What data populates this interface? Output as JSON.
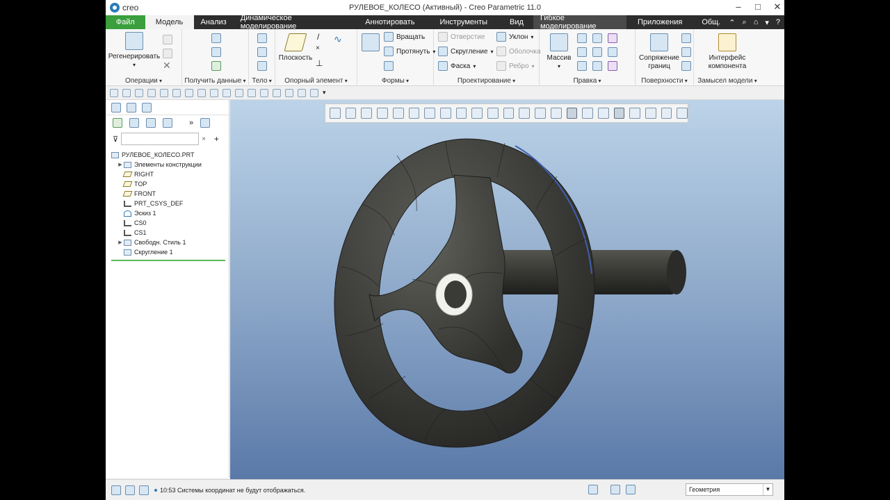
{
  "app": {
    "logo": "creo",
    "title": "РУЛЕВОЕ_КОЛЕСО (Активный) - Creo Parametric 11.0"
  },
  "tabs": {
    "file": "Файл",
    "model": "Модель",
    "analysis": "Анализ",
    "dynamic": "Динамическое моделирование",
    "annotate": "Аннотировать",
    "tools": "Инструменты",
    "view": "Вид",
    "flex": "Гибкое моделирование",
    "apps": "Приложения",
    "common": "Общ."
  },
  "ribbon": {
    "operations": {
      "label": "Операции",
      "regen": "Регенерировать"
    },
    "get_data": {
      "label": "Получить данные"
    },
    "body": {
      "label": "Тело"
    },
    "datum": {
      "label": "Опорный элемент",
      "plane": "Плоскость"
    },
    "shapes": {
      "label": "Формы",
      "revolve": "Вращать",
      "extrude": "Протянуть"
    },
    "engineering": {
      "label": "Проектирование",
      "hole": "Отверстие",
      "round": "Скругление",
      "chamfer": "Фаска",
      "draft": "Уклон",
      "shell": "Оболочка",
      "rib": "Ребро"
    },
    "editing": {
      "label": "Правка",
      "pattern": "Массив"
    },
    "surfaces": {
      "label": "Поверхности",
      "boundary": "Сопряжение границ"
    },
    "intent": {
      "label": "Замысел модели",
      "component_interface": "Интерфейс компонента"
    }
  },
  "tree": {
    "search_placeholder": "",
    "items": [
      {
        "label": "РУЛЕВОЕ_КОЛЕСО.PRT"
      },
      {
        "label": "Элементы конструкции"
      },
      {
        "label": "RIGHT"
      },
      {
        "label": "TOP"
      },
      {
        "label": "FRONT"
      },
      {
        "label": "PRT_CSYS_DEF"
      },
      {
        "label": "Эскиз 1"
      },
      {
        "label": "CS0"
      },
      {
        "label": "CS1"
      },
      {
        "label": "Свободн. Стиль 1"
      },
      {
        "label": "Скругление 1"
      }
    ]
  },
  "status": {
    "message": "10:53 Системы координат не будут отображаться.",
    "filter": "Геометрия"
  },
  "colors": {
    "file_tab": "#3a9f3c",
    "tab_bar": "#2d2d2d",
    "model_fill": "#3f3f3d",
    "viewport_top": "#bcd3e8",
    "viewport_bottom": "#5a79a8"
  }
}
